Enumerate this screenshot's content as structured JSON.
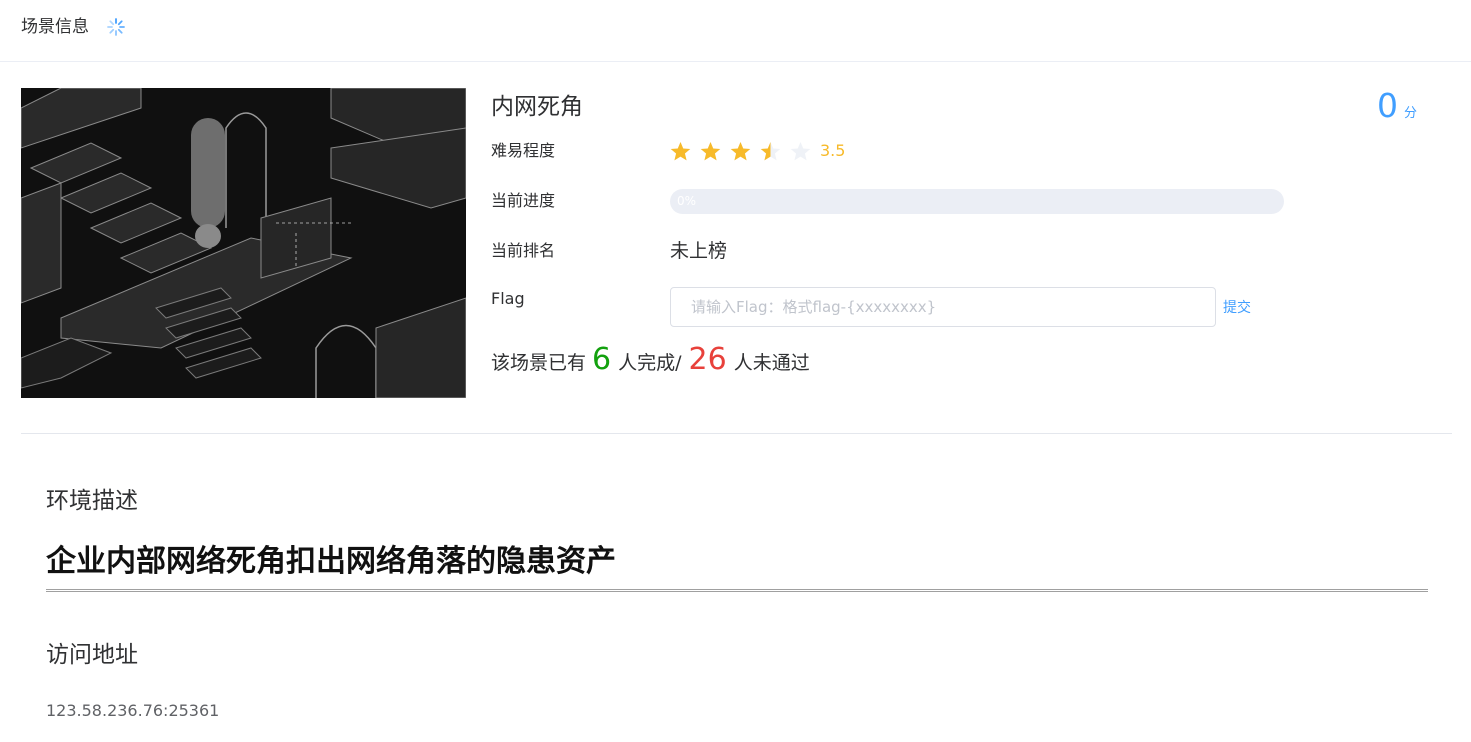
{
  "header": {
    "title": "场景信息"
  },
  "scene": {
    "name": "内网死角",
    "score_value": "0",
    "score_unit": "分",
    "image_icon": "scene-illustration"
  },
  "details": {
    "difficulty_label": "难易程度",
    "difficulty_rating": 3.5,
    "difficulty_max": 5,
    "difficulty_text": "3.5",
    "progress_label": "当前进度",
    "progress_percent": 0,
    "progress_text": "0%",
    "rank_label": "当前排名",
    "rank_value": "未上榜",
    "flag_label": "Flag",
    "flag_value": "",
    "flag_placeholder": "请输入Flag：格式flag-{xxxxxxxx}",
    "submit_label": "提交"
  },
  "stats": {
    "prefix": "该场景已有",
    "completed_count": "6",
    "completed_suffix": "人完成/",
    "failed_count": "26",
    "failed_suffix": "人未通过"
  },
  "environment": {
    "section_title": "环境描述",
    "heading": "企业内部网络死角扣出网络角落的隐患资产"
  },
  "access": {
    "section_title": "访问地址",
    "address": "123.58.236.76:25361"
  },
  "colors": {
    "accent": "#409eff",
    "star": "#f7ba2a",
    "star_empty": "#eff2f7",
    "success": "#13a10e",
    "danger": "#e8413b"
  }
}
